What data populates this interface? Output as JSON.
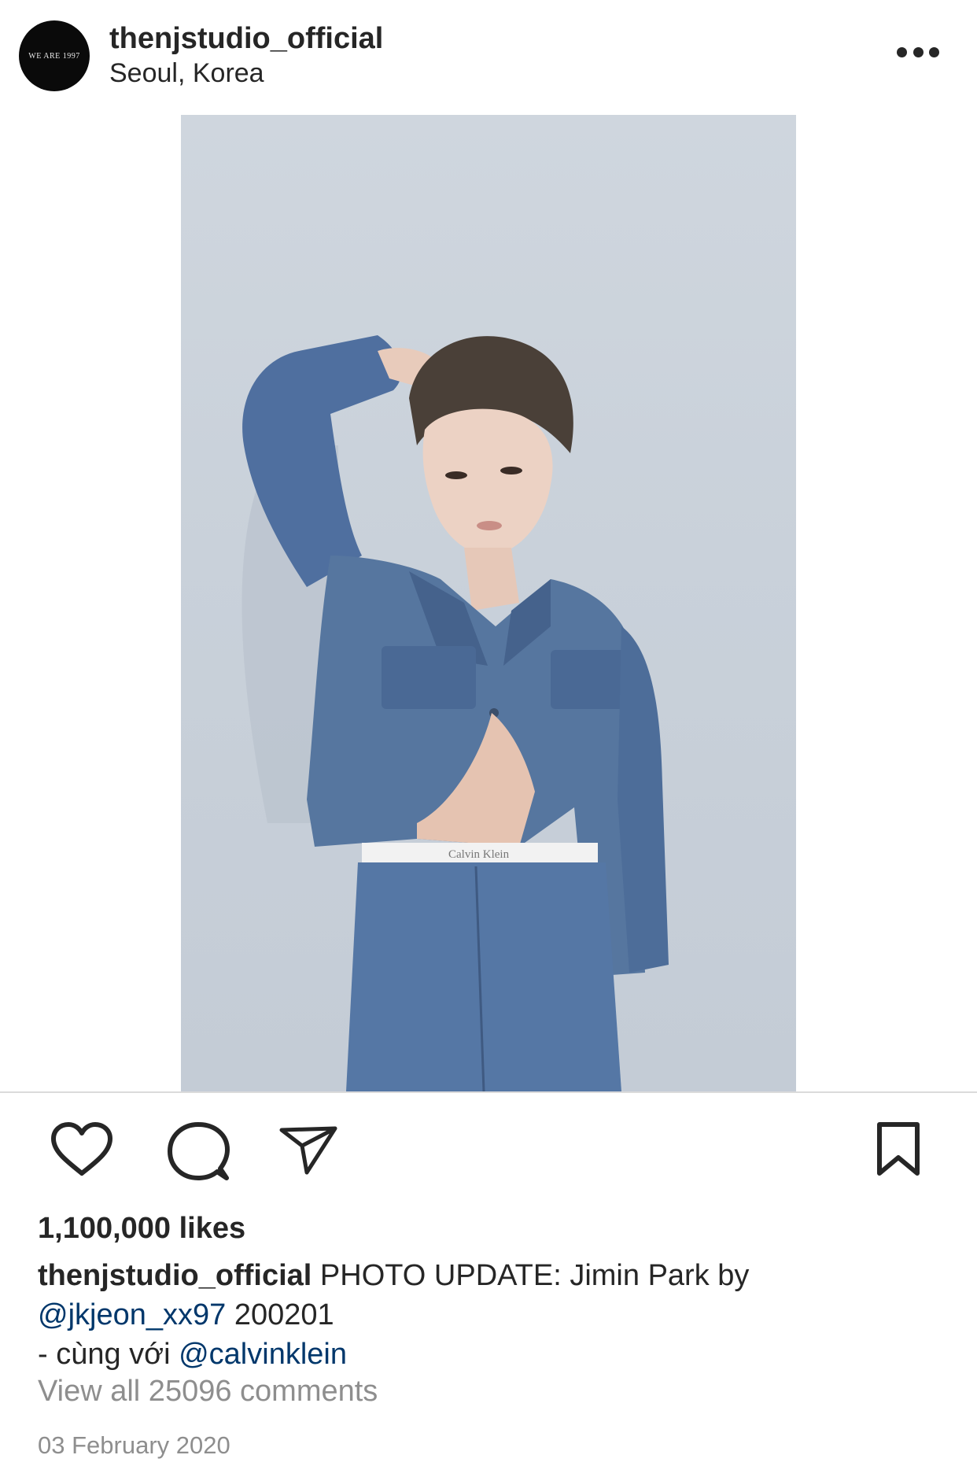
{
  "header": {
    "avatar_logo_text": "WE ARE 1997",
    "username": "thenjstudio_official",
    "location": "Seoul, Korea",
    "more_icon": "more-horizontal-icon"
  },
  "photo": {
    "waistband_text": "Calvin Klein"
  },
  "actions": {
    "like_icon": "heart-icon",
    "comment_icon": "comment-icon",
    "share_icon": "send-icon",
    "save_icon": "bookmark-icon"
  },
  "likes_text": "1,100,000 likes",
  "caption": {
    "username": "thenjstudio_official",
    "text_1": " PHOTO UPDATE: Jimin Park by",
    "mention_1": "@jkjeon_xx97",
    "text_2": " 200201",
    "text_3": "- cùng với ",
    "mention_2": "@calvinklein"
  },
  "view_comments": "View all 25096 comments",
  "date": "03 February 2020",
  "colors": {
    "text": "#262626",
    "secondary_text": "#8e8e8e",
    "mention": "#00376b",
    "divider": "#dbdbdb",
    "denim": "#4f6f9f"
  }
}
